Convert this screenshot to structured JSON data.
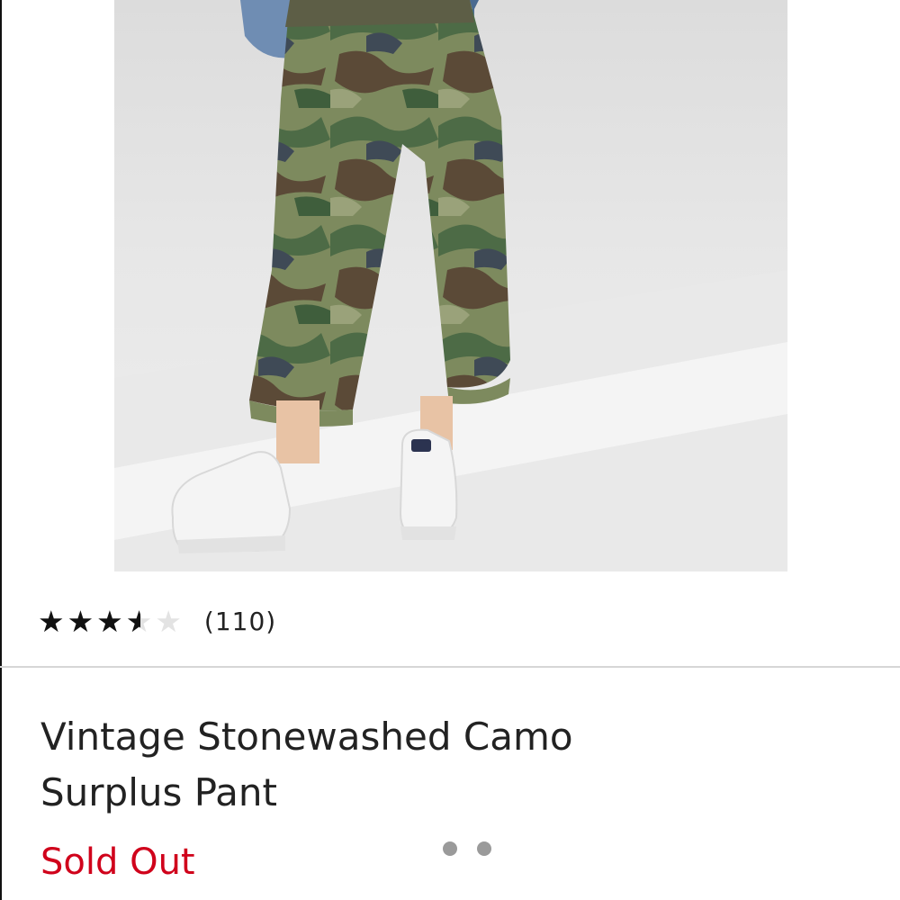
{
  "product": {
    "image_alt": "camo cargo pants with white platform sneakers",
    "rating": 3.5,
    "rating_max": 5,
    "stars_glyph": "★★★★★",
    "review_count": "(110)",
    "title": "Vintage Stonewashed Camo Surplus Pant",
    "status": "Sold Out"
  },
  "carousel": {
    "dot_count": 2,
    "active_index": 0
  },
  "colors": {
    "status_red": "#d0021b",
    "star_filled": "#111111",
    "star_empty": "#e3e3e3"
  }
}
